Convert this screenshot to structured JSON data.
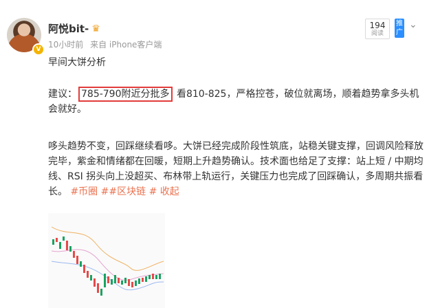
{
  "user": {
    "name": "阿悦bit-",
    "time": "10小时前",
    "source": "来自 iPhone客户端"
  },
  "reads": {
    "count": "194",
    "label": "阅读"
  },
  "promote_label": "推广",
  "post": {
    "line1": "早间大饼分析",
    "advice_prefix": "建议：",
    "advice_highlight": "785-790附近分批多",
    "advice_rest": "看810-825，严格控苍，破位就离场，顺着趋势拿多头机会就好。",
    "para_main": "哆头趋势不变，回踩继续看哆。大饼已经完成阶段性筑底，站稳关键支撑，回调风险释放完毕，紫金和情绪都在回暖，短期上升趋势确认。技术面也给足了支撑：站上短 / 中期均线、RSI 拐头向上没超买、布林带上轨运行，关键压力也完成了回踩确认，多周期共振看长。",
    "tag1": "#币圈",
    "tag2": "##区块链",
    "tag3": "# 收起"
  },
  "colors": {
    "accent": "#eb7350",
    "highlight_border": "#e23a3a",
    "candle_up": "#1aa260",
    "candle_down": "#e64a4a"
  }
}
